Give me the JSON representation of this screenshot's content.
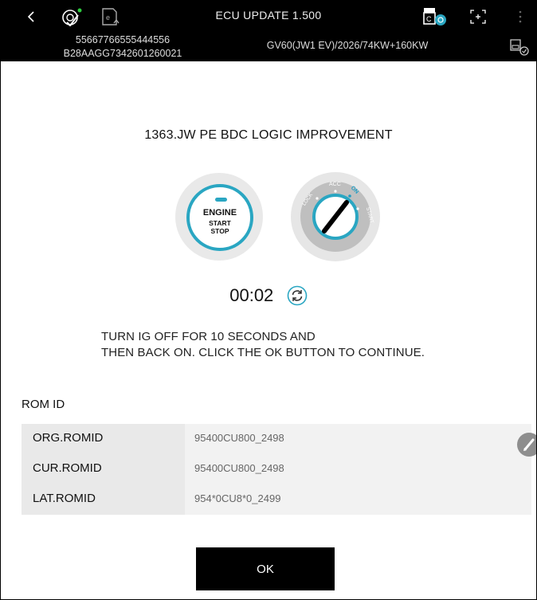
{
  "header": {
    "back_icon": "chevron-left-icon",
    "title": "ECU UPDATE 1.500",
    "vin_line1": "55667766555444556",
    "vin_line2": "B28AAGG7342601260021",
    "model": "GV60(JW1 EV)/2026/74KW+160KW"
  },
  "update": {
    "name": "1363.JW PE BDC LOGIC IMPROVEMENT",
    "engine_button": {
      "line1": "ENGINE",
      "line2": "START",
      "line3": "STOP"
    },
    "key_positions": {
      "lock": "LOCK",
      "acc": "ACC",
      "on": "ON",
      "start": "START"
    },
    "timer": "00:02",
    "instruction_line1": "TURN IG OFF FOR 10 SECONDS AND",
    "instruction_line2": "THEN BACK ON. CLICK THE OK BUTTON TO CONTINUE."
  },
  "rom": {
    "label": "ROM ID",
    "rows": [
      {
        "key": "ORG.ROMID",
        "value": "95400CU800_2498"
      },
      {
        "key": "CUR.ROMID",
        "value": "95400CU800_2498"
      },
      {
        "key": "LAT.ROMID",
        "value": "954*0CU8*0_2499"
      }
    ]
  },
  "ok_label": "OK",
  "colors": {
    "accent": "#2aa6c2",
    "bar": "#000000",
    "on_highlight": "#1e9dc4"
  }
}
